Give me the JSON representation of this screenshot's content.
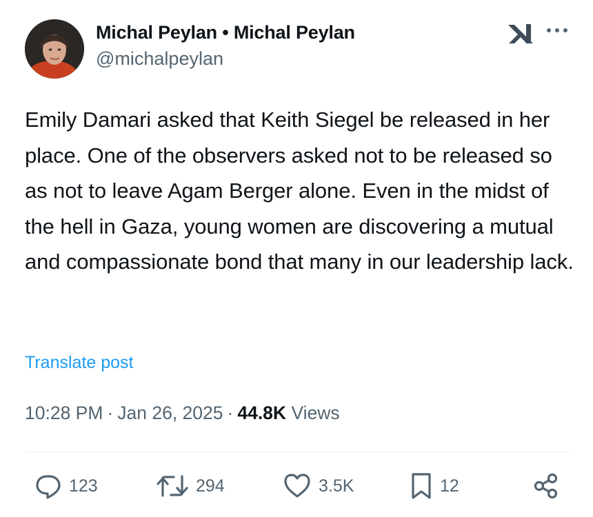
{
  "post": {
    "author_display": "Michal Peylan • Michal Peylan",
    "author_handle": "@michalpeylan",
    "text": "Emily Damari asked that Keith Siegel be released in her place. One of the observers asked not to be released so as not to leave Agam Berger alone. Even in the midst of the hell in Gaza, young women are discovering a mutual and compassionate bond that many in our leadership lack.",
    "translate_label": "Translate post",
    "time": "10:28 PM",
    "date": "Jan 26, 2025",
    "views_count": "44.8K",
    "views_label": "Views"
  },
  "actions": {
    "replies": "123",
    "reposts": "294",
    "likes": "3.5K",
    "bookmarks": "12"
  },
  "icons": {
    "logo": "x-logo-icon",
    "more": "more-icon",
    "reply": "reply-icon",
    "repost": "repost-icon",
    "like": "heart-icon",
    "bookmark": "bookmark-icon",
    "share": "share-icon"
  },
  "colors": {
    "text": "#0f1419",
    "secondary": "#536471",
    "link": "#1d9bf0"
  }
}
